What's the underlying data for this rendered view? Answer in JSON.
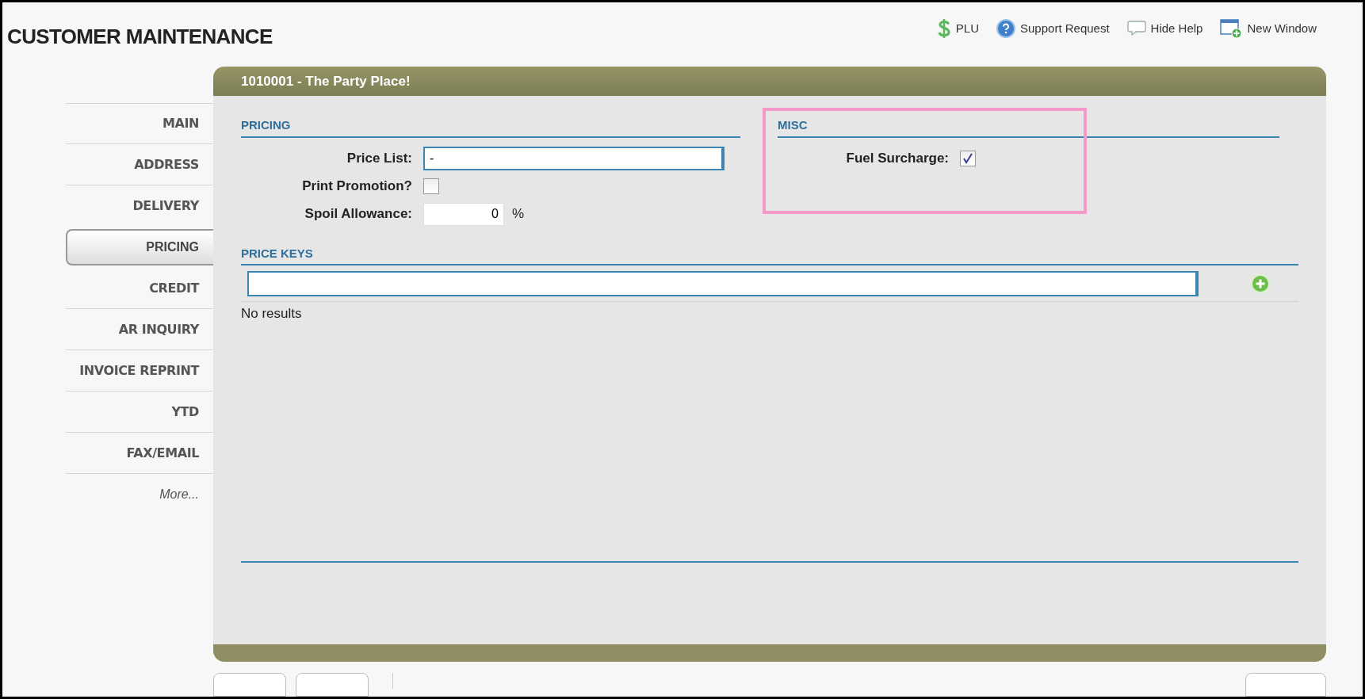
{
  "page_title": "CUSTOMER MAINTENANCE",
  "toolbar": [
    {
      "label": "PLU",
      "kind": "dollar"
    },
    {
      "label": "Support Request",
      "kind": "help"
    },
    {
      "label": "Hide Help",
      "kind": "speech"
    },
    {
      "label": "New Window",
      "kind": "window"
    }
  ],
  "panel_title": "1010001 - The Party Place!",
  "nav": [
    {
      "label": "MAIN",
      "selected": false
    },
    {
      "label": "ADDRESS",
      "selected": false
    },
    {
      "label": "DELIVERY",
      "selected": false
    },
    {
      "label": "PRICING",
      "selected": true
    },
    {
      "label": "CREDIT",
      "selected": false
    },
    {
      "label": "AR INQUIRY",
      "selected": false
    },
    {
      "label": "INVOICE REPRINT",
      "selected": false
    },
    {
      "label": "YTD",
      "selected": false
    },
    {
      "label": "FAX/EMAIL",
      "selected": false
    },
    {
      "label": "More...",
      "selected": false,
      "kind": "more"
    }
  ],
  "pricing": {
    "heading": "PRICING",
    "fields": [
      {
        "kind": "text",
        "label": "Price List:",
        "value": "-"
      },
      {
        "kind": "checkbox",
        "label": "Print Promotion?",
        "checked": false
      },
      {
        "kind": "percent",
        "label": "Spoil Allowance:",
        "value": "0",
        "unit": "%"
      }
    ]
  },
  "misc": {
    "heading": "MISC",
    "highlighted": true,
    "fields": [
      {
        "kind": "checkbox",
        "label": "Fuel Surcharge:",
        "checked": true
      }
    ]
  },
  "price_keys": {
    "heading": "PRICE KEYS",
    "empty_text": "No results"
  }
}
